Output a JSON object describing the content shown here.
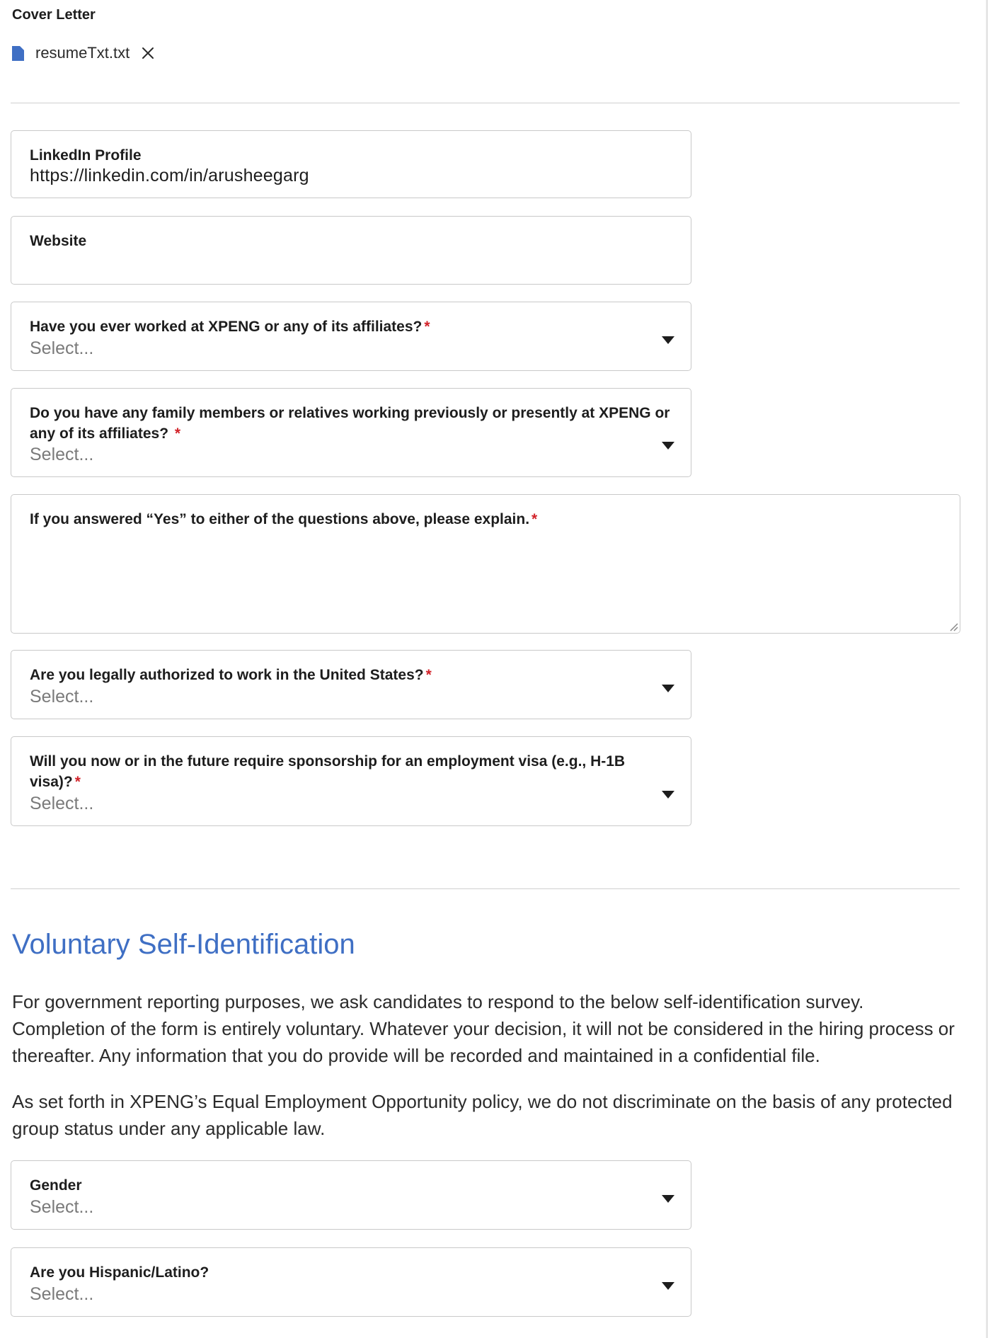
{
  "cover_letter": {
    "label": "Cover Letter",
    "file_name": "resumeTxt.txt",
    "file_icon": "document-icon",
    "remove_icon": "close-icon"
  },
  "linkedin": {
    "label": "LinkedIn Profile",
    "value": "https://linkedin.com/in/arusheegarg"
  },
  "website": {
    "label": "Website",
    "value": ""
  },
  "worked_at_xpeng": {
    "label": "Have you ever worked at XPENG or any of its affiliates?",
    "required_mark": "*",
    "placeholder": "Select..."
  },
  "family_members": {
    "label": "Do you have any family members or relatives working previously or presently at XPENG or any of its affiliates? ",
    "required_mark": "*",
    "placeholder": "Select..."
  },
  "explain": {
    "label": "If you answered “Yes” to either of the questions above, please explain.",
    "required_mark": "*",
    "value": ""
  },
  "authorized": {
    "label": "Are you legally authorized to work in the United States?",
    "required_mark": "*",
    "placeholder": "Select..."
  },
  "sponsorship": {
    "label": "Will you now or in the future require sponsorship for an employment visa (e.g., H-1B visa)?",
    "required_mark": "*",
    "placeholder": "Select..."
  },
  "self_id": {
    "title": "Voluntary Self-Identification",
    "paragraph_1": "For government reporting purposes, we ask candidates to respond to the below self-identification survey. Completion of the form is entirely voluntary. Whatever your decision, it will not be considered in the hiring process or thereafter. Any information that you do provide will be recorded and maintained in a confidential file.",
    "paragraph_2": "As set forth in XPENG’s Equal Employment Opportunity policy, we do not discriminate on the basis of any protected group status under any applicable law."
  },
  "gender": {
    "label": "Gender",
    "placeholder": "Select..."
  },
  "hispanic": {
    "label": "Are you Hispanic/Latino?",
    "placeholder": "Select..."
  },
  "colors": {
    "accent_title": "#3f6fc4",
    "file_icon": "#3f6fc4",
    "required": "#d2232a"
  },
  "icons": {
    "dropdown": "caret-down-icon",
    "resize": "resize-handle-icon"
  }
}
